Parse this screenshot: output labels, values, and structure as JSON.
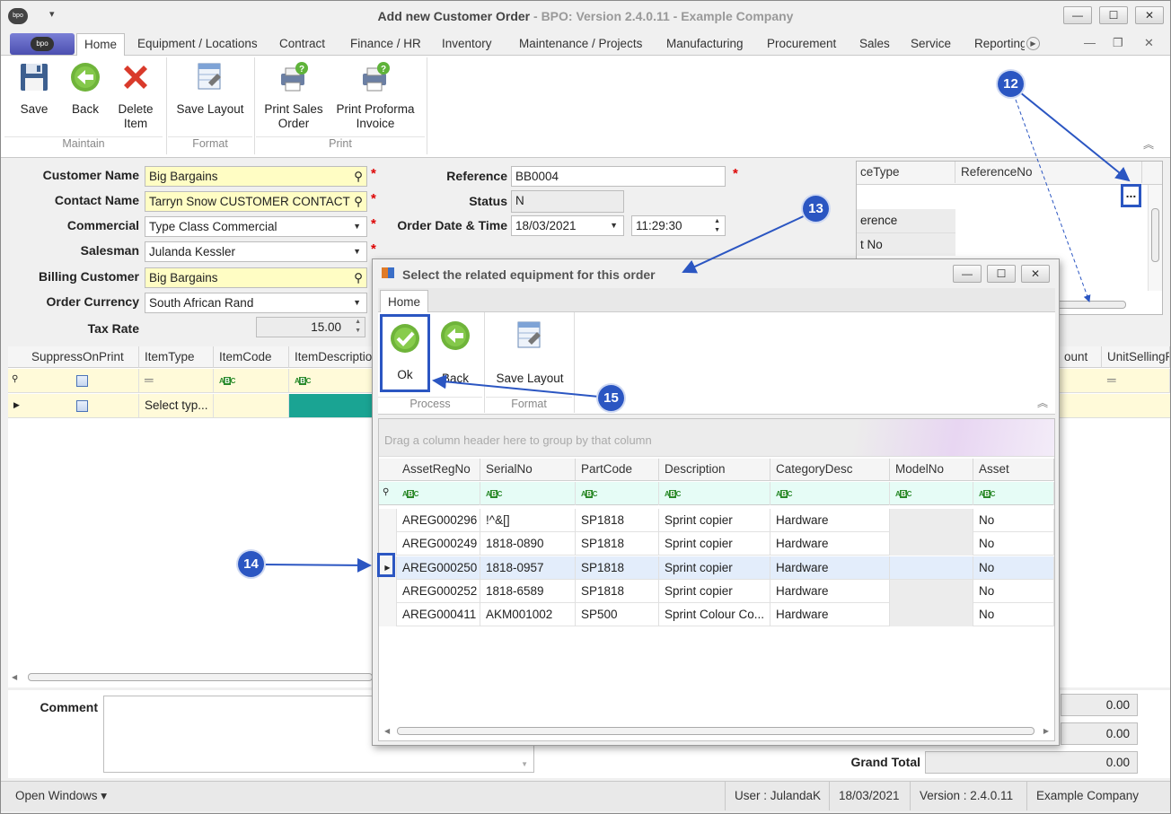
{
  "window": {
    "title": "Add new Customer Order",
    "subtitle": " - BPO: Version 2.4.0.11 - Example Company",
    "logo": "bpo"
  },
  "tabs": [
    "Home",
    "Equipment / Locations",
    "Contract",
    "Finance / HR",
    "Inventory",
    "Maintenance / Projects",
    "Manufacturing",
    "Procurement",
    "Sales",
    "Service",
    "Reporting"
  ],
  "ribbon": {
    "save": "Save",
    "back": "Back",
    "delete_line1": "Delete",
    "delete_line2": "Item",
    "save_layout": "Save Layout",
    "print_sales_line1": "Print Sales",
    "print_sales_line2": "Order",
    "print_proforma_line1": "Print Proforma",
    "print_proforma_line2": "Invoice",
    "group_maintain": "Maintain",
    "group_format": "Format",
    "group_print": "Print"
  },
  "form": {
    "customer_name_label": "Customer Name",
    "customer_name": "Big Bargains",
    "contact_name_label": "Contact Name",
    "contact_name": "Tarryn Snow CUSTOMER CONTACT",
    "commercial_label": "Commercial",
    "commercial": "Type Class Commercial",
    "salesman_label": "Salesman",
    "salesman": "Julanda Kessler",
    "billing_customer_label": "Billing Customer",
    "billing_customer": "Big Bargains",
    "order_currency_label": "Order Currency",
    "order_currency": "South African Rand",
    "tax_rate_label": "Tax Rate",
    "tax_rate": "15.00",
    "reference_label": "Reference",
    "reference": "BB0004",
    "status_label": "Status",
    "status": "N",
    "order_date_label": "Order Date & Time",
    "order_date": "18/03/2021",
    "order_time": "11:29:30"
  },
  "refpanel": {
    "col1": "ceType",
    "col2": "ReferenceNo",
    "row1": "erence",
    "row2": "t No",
    "ellipsis": "..."
  },
  "items_grid": {
    "headers": [
      "SuppressOnPrint",
      "ItemType",
      "ItemCode",
      "ItemDescription"
    ],
    "right_headers": [
      "ount",
      "UnitSellingP"
    ],
    "new_row_itemtype": "Select typ..."
  },
  "comment_label": "Comment",
  "totals": {
    "v1": "0.00",
    "v2": "0.00",
    "grand_total_label": "Grand Total",
    "grand_total": "0.00"
  },
  "dialog": {
    "title": "Select the related equipment for this order",
    "tab": "Home",
    "ok": "Ok",
    "back": "Back",
    "save_layout": "Save Layout",
    "group_process": "Process",
    "group_format": "Format",
    "group_hint": "Drag a column header here to group by that column",
    "columns": [
      "AssetRegNo",
      "SerialNo",
      "PartCode",
      "Description",
      "CategoryDesc",
      "ModelNo",
      "Asset"
    ],
    "rows": [
      [
        "AREG000296",
        "!^&[]",
        "SP1818",
        "Sprint copier",
        "Hardware",
        "",
        "No"
      ],
      [
        "AREG000249",
        "1818-0890",
        "SP1818",
        "Sprint copier",
        "Hardware",
        "",
        "No"
      ],
      [
        "AREG000250",
        "1818-0957",
        "SP1818",
        "Sprint copier",
        "Hardware",
        "",
        "No"
      ],
      [
        "AREG000252",
        "1818-6589",
        "SP1818",
        "Sprint copier",
        "Hardware",
        "",
        "No"
      ],
      [
        "AREG000411",
        "AKM001002",
        "SP500",
        "Sprint Colour Co...",
        "Hardware",
        "",
        "No"
      ]
    ],
    "selected_row": 2
  },
  "callouts": [
    "12",
    "13",
    "14",
    "15"
  ],
  "statusbar": {
    "open_windows": "Open Windows ▾",
    "user": "User : JulandaK",
    "date": "18/03/2021",
    "version": "Version : 2.4.0.11",
    "company": "Example Company"
  },
  "colors": {
    "callout": "#2b56c2",
    "required_field": "#fffdc4",
    "selected_row": "#e3edfb",
    "filter_row": "#e8fbf6",
    "teal_cell": "#1aa493"
  }
}
